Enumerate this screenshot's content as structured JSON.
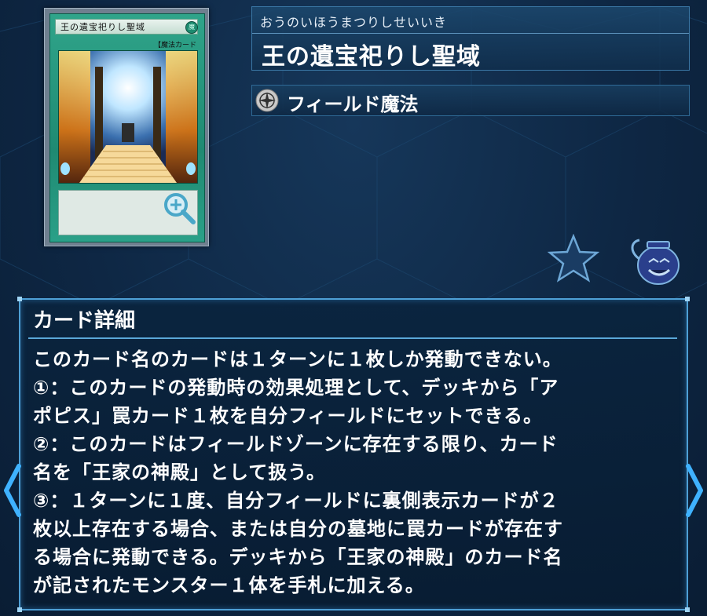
{
  "card": {
    "image_name": "王の遺宝祀りし聖域",
    "image_type_line": "【魔法カード",
    "image_attribute": "魔"
  },
  "name": {
    "reading": "おうのいほうまつりしせいいき",
    "title": "王の遺宝祀りし聖域"
  },
  "type": {
    "icon": "field-spell-icon",
    "label": "フィールド魔法"
  },
  "actions": {
    "favorite_icon": "star-icon",
    "collection_icon": "pot-icon"
  },
  "detail": {
    "heading": "カード詳細",
    "text": "このカード名のカードは１ターンに１枚しか発動できない。\n①：このカードの発動時の効果処理として、デッキから「ア\nポピス」罠カード１枚を自分フィールドにセットできる。\n②：このカードはフィールドゾーンに存在する限り、カード\n名を「王家の神殿」として扱う。\n③：１ターンに１度、自分フィールドに裏側表示カードが２\n枚以上存在する場合、または自分の墓地に罠カードが存在す\nる場合に発動できる。デッキから「王家の神殿」のカード名\nが記されたモンスター１体を手札に加える。"
  },
  "colors": {
    "accent": "#4ea0d6",
    "background": "#0e2744",
    "card_frame": "#1f8a72"
  }
}
